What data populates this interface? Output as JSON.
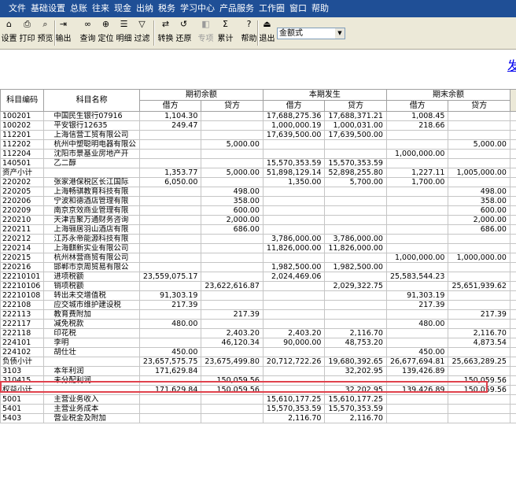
{
  "menu": [
    "文件",
    "基础设置",
    "总账",
    "往来",
    "现金",
    "出纳",
    "税务",
    "学习中心",
    "产品服务",
    "工作圈",
    "窗口",
    "帮助"
  ],
  "toolbar": {
    "buttons": [
      {
        "label": "设置",
        "icon": "settings-icon"
      },
      {
        "label": "打印",
        "icon": "printer-icon"
      },
      {
        "label": "预览",
        "icon": "preview-icon"
      },
      {
        "label": "输出",
        "icon": "export-icon"
      },
      {
        "label": "查询",
        "icon": "binoculars-icon"
      },
      {
        "label": "定位",
        "icon": "locate-icon"
      },
      {
        "label": "明细",
        "icon": "detail-icon"
      },
      {
        "label": "过滤",
        "icon": "filter-icon"
      },
      {
        "label": "转换",
        "icon": "convert-icon"
      },
      {
        "label": "还原",
        "icon": "restore-icon"
      },
      {
        "label": "专项",
        "icon": "special-icon",
        "disabled": true
      },
      {
        "label": "累计",
        "icon": "sigma-icon"
      },
      {
        "label": "帮助",
        "icon": "help-icon"
      },
      {
        "label": "退出",
        "icon": "exit-icon"
      }
    ],
    "format_select": "金额式"
  },
  "title_fragment": "发",
  "table": {
    "col_code": "科目编码",
    "col_name": "科目名称",
    "group_opening": "期初余额",
    "group_current": "本期发生",
    "group_closing": "期末余额",
    "debit": "借方",
    "credit": "贷方",
    "rows": [
      [
        "100201",
        "中国民生银行07916",
        "1,104.30",
        "",
        "17,688,275.36",
        "17,688,371.21",
        "1,008.45",
        ""
      ],
      [
        "100202",
        "平安银行12635",
        "249.47",
        "",
        "1,000,000.19",
        "1,000,031.00",
        "218.66",
        ""
      ],
      [
        "112201",
        "上海信营工贸有限公司",
        "",
        "",
        "17,639,500.00",
        "17,639,500.00",
        "",
        ""
      ],
      [
        "112202",
        "杭州中塑聪明电器有限公",
        "",
        "5,000.00",
        "",
        "",
        "",
        "5,000.00"
      ],
      [
        "112204",
        "沈阳市景基业房地产开",
        "",
        "",
        "",
        "",
        "1,000,000.00",
        ""
      ],
      [
        "140501",
        "乙二醇",
        "",
        "",
        "15,570,353.59",
        "15,570,353.59",
        "",
        ""
      ],
      [
        "资产小计",
        "",
        "1,353.77",
        "5,000.00",
        "51,898,129.14",
        "52,898,255.80",
        "1,227.11",
        "1,005,000.00"
      ],
      [
        "220202",
        "张家港保税区长江国际",
        "6,050.00",
        "",
        "1,350.00",
        "5,700.00",
        "1,700.00",
        ""
      ],
      [
        "220205",
        "上海畅骐教育科技有限",
        "",
        "498.00",
        "",
        "",
        "",
        "498.00"
      ],
      [
        "220206",
        "宁波和德酒店管理有限",
        "",
        "358.00",
        "",
        "",
        "",
        "358.00"
      ],
      [
        "220209",
        "南京京效商业管理有限",
        "",
        "600.00",
        "",
        "",
        "",
        "600.00"
      ],
      [
        "220210",
        "天津吉聚万通财务咨询",
        "",
        "2,000.00",
        "",
        "",
        "",
        "2,000.00"
      ],
      [
        "220211",
        "上海骊居羽山酒店有限",
        "",
        "686.00",
        "",
        "",
        "",
        "686.00"
      ],
      [
        "220212",
        "江苏永帝能源科技有限",
        "",
        "",
        "3,786,000.00",
        "3,786,000.00",
        "",
        ""
      ],
      [
        "220214",
        "上海麒新实业有限公司",
        "",
        "",
        "11,826,000.00",
        "11,826,000.00",
        "",
        ""
      ],
      [
        "220215",
        "杭州林营商贸有限公司",
        "",
        "",
        "",
        "",
        "1,000,000.00",
        "1,000,000.00"
      ],
      [
        "220216",
        "邯郸市京周贸易有限公",
        "",
        "",
        "1,982,500.00",
        "1,982,500.00",
        "",
        ""
      ],
      [
        "22210101",
        "进项税额",
        "23,559,075.17",
        "",
        "2,024,469.06",
        "",
        "25,583,544.23",
        ""
      ],
      [
        "22210106",
        "销项税额",
        "",
        "23,622,616.87",
        "",
        "2,029,322.75",
        "",
        "25,651,939.62"
      ],
      [
        "22210108",
        "转出未交增值税",
        "91,303.19",
        "",
        "",
        "",
        "91,303.19",
        ""
      ],
      [
        "222108",
        "应交城市维护建设税",
        "217.39",
        "",
        "",
        "",
        "217.39",
        ""
      ],
      [
        "222113",
        "教育费附加",
        "",
        "217.39",
        "",
        "",
        "",
        "217.39"
      ],
      [
        "222117",
        "减免税款",
        "480.00",
        "",
        "",
        "",
        "480.00",
        ""
      ],
      [
        "222118",
        "印花税",
        "",
        "2,403.20",
        "2,403.20",
        "2,116.70",
        "",
        "2,116.70"
      ],
      [
        "224101",
        "李明",
        "",
        "46,120.34",
        "90,000.00",
        "48,753.20",
        "",
        "4,873.54"
      ],
      [
        "224102",
        "胡仕壮",
        "450.00",
        "",
        "",
        "",
        "450.00",
        ""
      ],
      [
        "负债小计",
        "",
        "23,657,575.75",
        "23,675,499.80",
        "20,712,722.26",
        "19,680,392.65",
        "26,677,694.81",
        "25,663,289.25"
      ],
      [
        "3103",
        "本年利润",
        "171,629.84",
        "",
        "",
        "32,202.95",
        "139,426.89",
        ""
      ],
      [
        "310415",
        "未分配利润",
        "",
        "150,059.56",
        "",
        "",
        "",
        "150,059.56"
      ],
      [
        "权益小计",
        "",
        "171,629.84",
        "150,059.56",
        "",
        "32,202.95",
        "139,426.89",
        "150,059.56"
      ],
      [
        "5001",
        "主营业务收入",
        "",
        "",
        "15,610,177.25",
        "15,610,177.25",
        "",
        ""
      ],
      [
        "5401",
        "主营业务成本",
        "",
        "",
        "15,570,353.59",
        "15,570,353.59",
        "",
        ""
      ],
      [
        "5403",
        "营业税金及附加",
        "",
        "",
        "2,116.70",
        "2,116.70",
        "",
        ""
      ]
    ]
  }
}
